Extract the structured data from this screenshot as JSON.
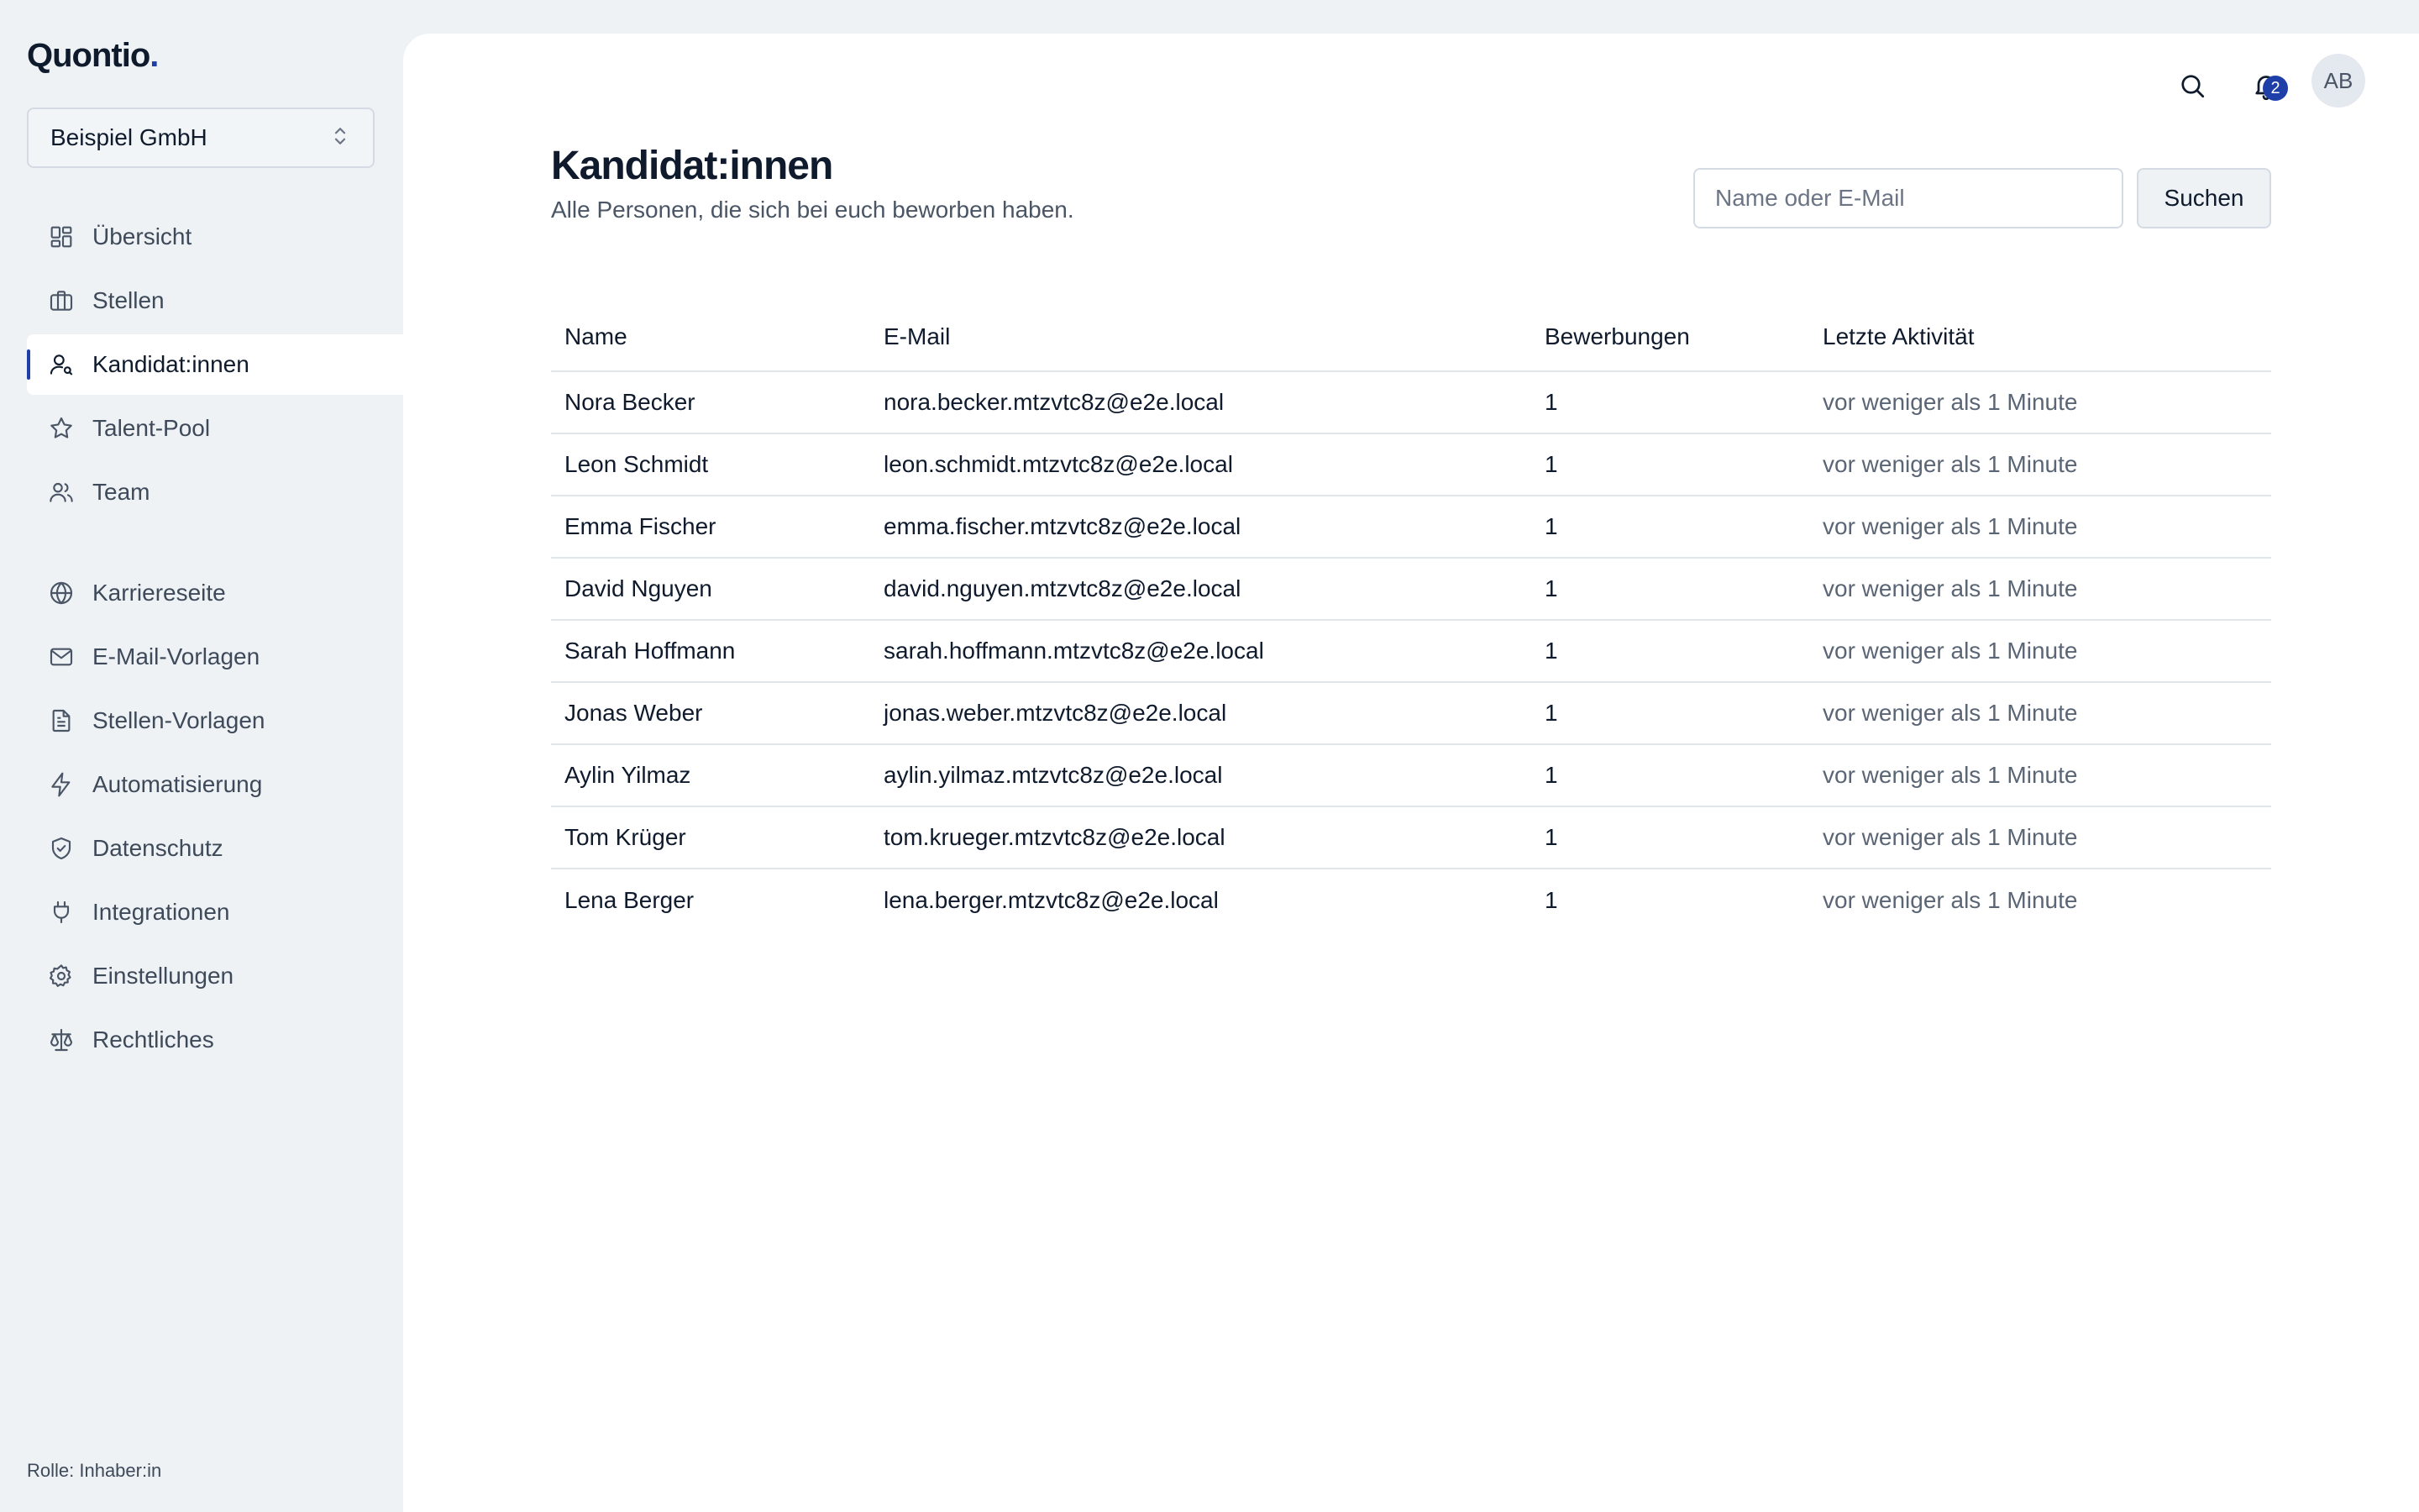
{
  "app": {
    "logo_text": "Quontio",
    "logo_dot": "."
  },
  "workspace": {
    "name": "Beispiel GmbH"
  },
  "sidebar": {
    "primary": [
      {
        "label": "Übersicht",
        "icon": "dashboard-icon"
      },
      {
        "label": "Stellen",
        "icon": "briefcase-icon"
      },
      {
        "label": "Kandidat:innen",
        "icon": "user-search-icon",
        "active": true
      },
      {
        "label": "Talent-Pool",
        "icon": "star-icon"
      },
      {
        "label": "Team",
        "icon": "users-icon"
      }
    ],
    "secondary": [
      {
        "label": "Karriereseite",
        "icon": "globe-icon"
      },
      {
        "label": "E-Mail-Vorlagen",
        "icon": "mail-icon"
      },
      {
        "label": "Stellen-Vorlagen",
        "icon": "document-icon"
      },
      {
        "label": "Automatisierung",
        "icon": "bolt-icon"
      },
      {
        "label": "Datenschutz",
        "icon": "shield-check-icon"
      },
      {
        "label": "Integrationen",
        "icon": "plug-icon"
      },
      {
        "label": "Einstellungen",
        "icon": "gear-icon"
      },
      {
        "label": "Rechtliches",
        "icon": "scale-icon"
      }
    ],
    "role": "Rolle: Inhaber:in"
  },
  "topbar": {
    "notifications_count": "2",
    "avatar_initials": "AB"
  },
  "page": {
    "title": "Kandidat:innen",
    "subtitle": "Alle Personen, die sich bei euch beworben haben."
  },
  "search": {
    "placeholder": "Name oder E-Mail",
    "value": "",
    "button_label": "Suchen"
  },
  "table": {
    "headers": [
      "Name",
      "E-Mail",
      "Bewerbungen",
      "Letzte Aktivität"
    ],
    "rows": [
      {
        "name": "Nora Becker",
        "email": "nora.becker.mtzvtc8z@e2e.local",
        "applications": "1",
        "last_activity": "vor weniger als 1 Minute"
      },
      {
        "name": "Leon Schmidt",
        "email": "leon.schmidt.mtzvtc8z@e2e.local",
        "applications": "1",
        "last_activity": "vor weniger als 1 Minute"
      },
      {
        "name": "Emma Fischer",
        "email": "emma.fischer.mtzvtc8z@e2e.local",
        "applications": "1",
        "last_activity": "vor weniger als 1 Minute"
      },
      {
        "name": "David Nguyen",
        "email": "david.nguyen.mtzvtc8z@e2e.local",
        "applications": "1",
        "last_activity": "vor weniger als 1 Minute"
      },
      {
        "name": "Sarah Hoffmann",
        "email": "sarah.hoffmann.mtzvtc8z@e2e.local",
        "applications": "1",
        "last_activity": "vor weniger als 1 Minute"
      },
      {
        "name": "Jonas Weber",
        "email": "jonas.weber.mtzvtc8z@e2e.local",
        "applications": "1",
        "last_activity": "vor weniger als 1 Minute"
      },
      {
        "name": "Aylin Yilmaz",
        "email": "aylin.yilmaz.mtzvtc8z@e2e.local",
        "applications": "1",
        "last_activity": "vor weniger als 1 Minute"
      },
      {
        "name": "Tom Krüger",
        "email": "tom.krueger.mtzvtc8z@e2e.local",
        "applications": "1",
        "last_activity": "vor weniger als 1 Minute"
      },
      {
        "name": "Lena Berger",
        "email": "lena.berger.mtzvtc8z@e2e.local",
        "applications": "1",
        "last_activity": "vor weniger als 1 Minute"
      }
    ]
  },
  "colors": {
    "accent": "#1e3fa8",
    "sidebar_bg": "#eef2f5",
    "text": "#0f1b2d",
    "muted": "#5a6575"
  }
}
